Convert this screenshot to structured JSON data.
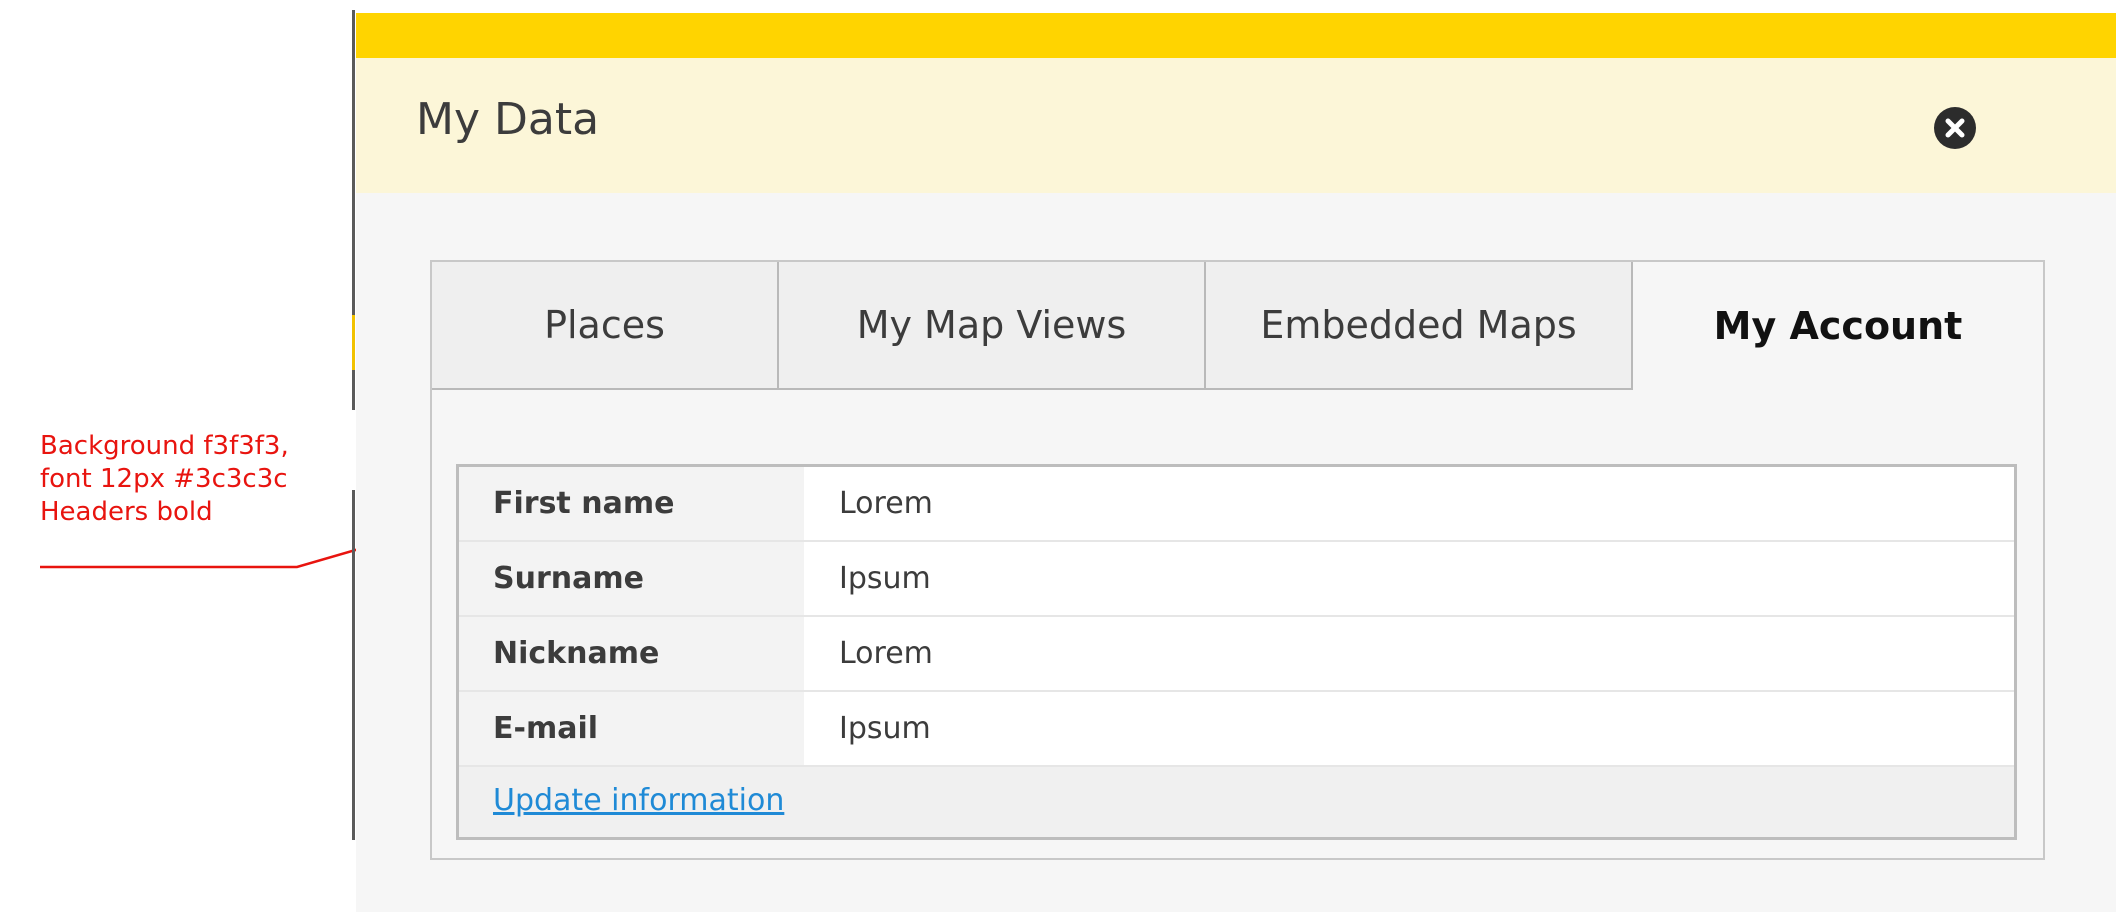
{
  "annotation": {
    "lines": [
      "Background f3f3f3,",
      "font 12px #3c3c3c",
      "Headers bold"
    ],
    "color": "#e8140f"
  },
  "dialog": {
    "title": "My Data",
    "close_icon": "close-circle-icon",
    "accent_color": "#ffd400",
    "header_bg": "#fcf6d8"
  },
  "tabs": [
    {
      "label": "Places",
      "active": false
    },
    {
      "label": "My Map Views",
      "active": false
    },
    {
      "label": "Embedded Maps",
      "active": false
    },
    {
      "label": "My Account",
      "active": true
    }
  ],
  "account": {
    "rows": [
      {
        "header": "First name",
        "value": "Lorem"
      },
      {
        "header": "Surname",
        "value": "Ipsum"
      },
      {
        "header": "Nickname",
        "value": "Lorem"
      },
      {
        "header": "E-mail",
        "value": "Ipsum"
      }
    ],
    "update_link": "Update information",
    "header_bg": "#f3f3f3",
    "text_color": "#3c3c3c",
    "link_color": "#1f8ad6"
  }
}
